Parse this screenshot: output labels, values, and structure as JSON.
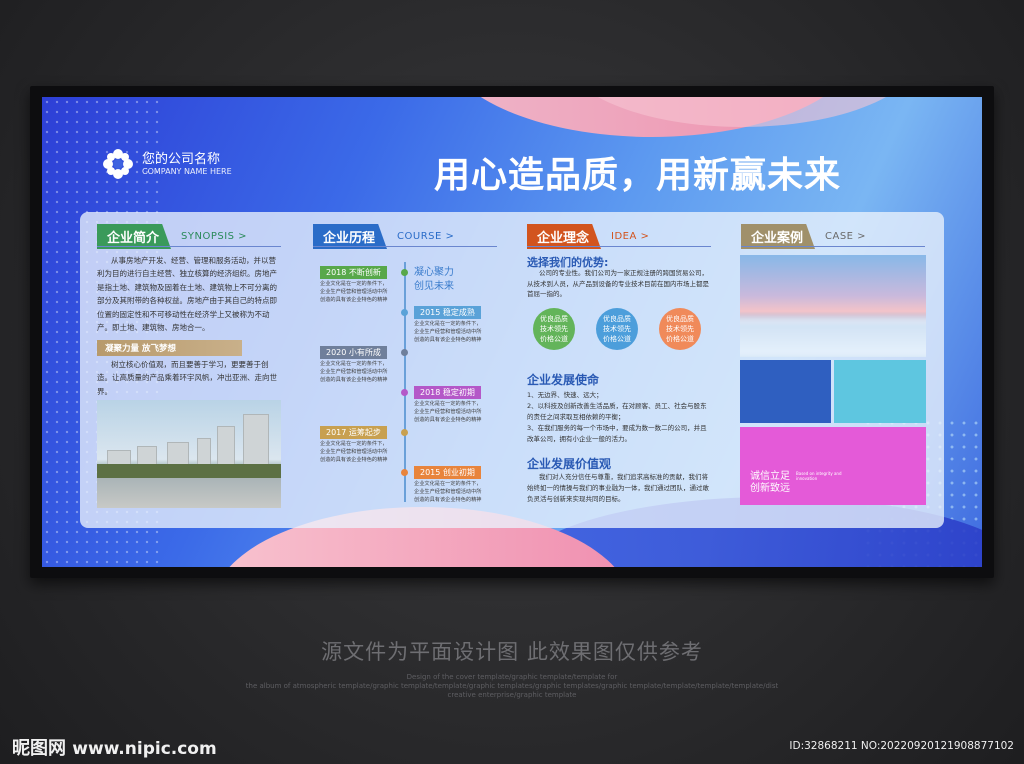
{
  "board": {
    "company_name": "您的公司名称",
    "company_sub": "COMPANY NAME HERE",
    "slogan": "用心造品质，用新赢未来"
  },
  "synopsis": {
    "tag": "企业简介",
    "sub": "SYNOPSIS >",
    "body": "从事房地产开发、经营、管理和服务活动，并以营利为目的进行自主经营、独立核算的经济组织。房地产是指土地、建筑物及固着在土地、建筑物上不可分离的部分及其附带的各种权益。房地产由于其自己的特点即位置的固定性和不可移动性在经济学上又被称为不动产。即土地、建筑物、房地合一。",
    "bar": "凝聚力量 放飞梦想",
    "bar_text": "树立核心价值观，而且要善于学习，更要善于创造。让高质量的产品乘着环宇风帆，冲出亚洲、走向世界。"
  },
  "course": {
    "tag": "企业历程",
    "sub": "COURSE >",
    "motto": "凝心聚力\n创见未来",
    "entries": [
      {
        "year": "2018 不断创新",
        "color": "#58a84a"
      },
      {
        "year": "2015 稳定成熟",
        "color": "#5aa2d8"
      },
      {
        "year": "2020 小有所成",
        "color": "#6f7f9b"
      },
      {
        "year": "2018 稳定初期",
        "color": "#b458c8"
      },
      {
        "year": "2017 运筹起步",
        "color": "#c8a050"
      },
      {
        "year": "2015 创业初期",
        "color": "#e8843c"
      }
    ],
    "entry_text": "企业文化是在一定的条件下，企业生产经营和管理活动中所创造的具有该企业特色的精神财富和物质形态。它包括文化观念、价值观念、企业精神、道德规范、行为准则、历史传统、企业制度、文化环境、企业产品等。其中价值观是企业文化的核心。"
  },
  "idea": {
    "tag": "企业理念",
    "sub": "IDEA >",
    "advantage_title": "选择我们的优势:",
    "advantage_text": "公司的专业性。我们公司为一家正规注册的跨国贸易公司，从技术到人员，从产品到设备的专业技术目前在国内市场上都是首屈一指的。",
    "circles": [
      {
        "label": "优良品质\n技术领先\n价格公道",
        "color": "#63b45a"
      },
      {
        "label": "优良品质\n技术领先\n价格公道",
        "color": "#4c9edb"
      },
      {
        "label": "优良品质\n技术领先\n价格公道",
        "color": "#f08a5a"
      }
    ],
    "mission_title": "企业发展使命",
    "mission_items": [
      "1、无边界、快速、远大；",
      "2、以科技及创新改善生活品质，在对顾客、员工、社会与股东的责任之间求取互相依赖的平衡；",
      "3、在我们服务的每一个市场中，要成为数一数二的公司，并且改革公司，拥有小企业一般的活力。"
    ],
    "values_title": "企业发展价值观",
    "values_text": "我们对人充分信任与尊重，我们追求高标准的贡献，我们将始终如一的情操与我们的事业融为一体，我们通过团队，通过敢负灵活与创新来实现共同的目标。"
  },
  "case": {
    "tag": "企业案例",
    "sub": "CASE >",
    "block_text": "诚信立足\n创新致远",
    "block_small": "Based on integrity and innovation"
  },
  "notice": {
    "main": "源文件为平面设计图 此效果图仅供参考",
    "fine1": "Design of the cover template/graphic template/template for",
    "fine2": "the album of atmospheric template/graphic template/template/graphic templates/graphic templates/graphic template/template/template/template/dist",
    "fine3": "creative enterprise/graphic template"
  },
  "watermark": {
    "brand": "昵图网",
    "url": "www.nipic.com",
    "id": "ID:32868211 NO:20220920121908877102"
  }
}
